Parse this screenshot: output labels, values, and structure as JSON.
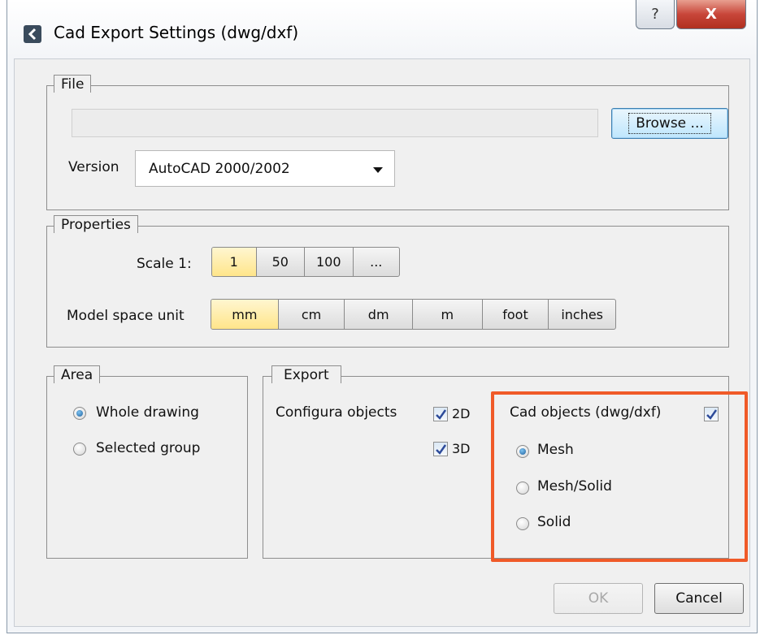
{
  "window": {
    "title": "Cad Export Settings (dwg/dxf)",
    "help_label": "?",
    "close_label": "X"
  },
  "file": {
    "legend": "File",
    "path_value": "",
    "browse_label": "Browse ...",
    "version_label": "Version",
    "version_value": "AutoCAD 2000/2002"
  },
  "properties": {
    "legend": "Properties",
    "scale_label": "Scale 1:",
    "scale_options": [
      "1",
      "50",
      "100",
      "..."
    ],
    "scale_selected": "1",
    "unit_label": "Model space unit",
    "unit_options": [
      "mm",
      "cm",
      "dm",
      "m",
      "foot",
      "inches"
    ],
    "unit_selected": "mm"
  },
  "area": {
    "legend": "Area",
    "options": [
      "Whole drawing",
      "Selected group"
    ],
    "selected": "Whole drawing"
  },
  "export": {
    "legend": "Export",
    "configura_label": "Configura objects",
    "check_2d_label": "2D",
    "check_3d_label": "3D",
    "check_2d": true,
    "check_3d": true,
    "cad_objects_label": "Cad objects (dwg/dxf)",
    "cad_objects_checked": true,
    "options": [
      "Mesh",
      "Mesh/Solid",
      "Solid"
    ],
    "selected": "Mesh"
  },
  "footer": {
    "ok_label": "OK",
    "cancel_label": "Cancel"
  },
  "colors": {
    "highlight": "#f05a28",
    "active_segment": "#ffe58a"
  }
}
